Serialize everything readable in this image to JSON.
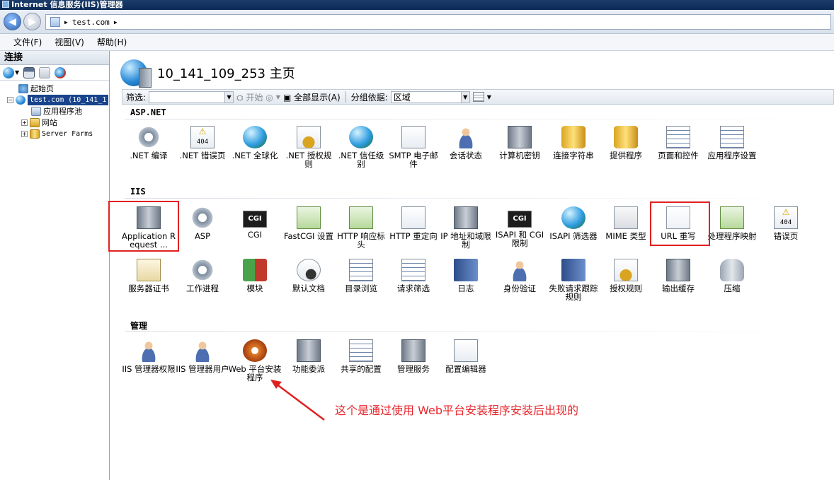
{
  "window": {
    "title": "Internet 信息服务(IIS)管理器"
  },
  "address": {
    "segments": [
      "test.com"
    ]
  },
  "menu": [
    "文件(F)",
    "视图(V)",
    "帮助(H)"
  ],
  "connections": {
    "header": "连接",
    "tree": [
      {
        "label": "起始页"
      },
      {
        "label": "test.com (10_141_1"
      },
      {
        "label": "应用程序池"
      },
      {
        "label": "网站"
      },
      {
        "label": "Server Farms"
      }
    ]
  },
  "main": {
    "title": "10_141_109_253 主页",
    "filter": {
      "label": "筛选:",
      "start": "开始",
      "show_all": "全部显示(A)",
      "group_by_label": "分组依据:",
      "group_by_value": "区域"
    },
    "sections": {
      "aspnet": "ASP.NET",
      "iis": "IIS",
      "manage": "管理"
    },
    "aspnet_features": [
      {
        "label": ".NET 编译",
        "icon": "compile-icon"
      },
      {
        "label": ".NET 错误页",
        "icon": "error-404-icon"
      },
      {
        "label": ".NET 全球化",
        "icon": "globe-icon"
      },
      {
        "label": ".NET 授权规则",
        "icon": "authorization-icon"
      },
      {
        "label": ".NET 信任级别",
        "icon": "trust-icon"
      },
      {
        "label": "SMTP 电子邮件",
        "icon": "smtp-icon"
      },
      {
        "label": "会话状态",
        "icon": "session-icon"
      },
      {
        "label": "计算机密钥",
        "icon": "machine-key-icon"
      },
      {
        "label": "连接字符串",
        "icon": "connection-string-icon"
      },
      {
        "label": "提供程序",
        "icon": "providers-icon"
      },
      {
        "label": "页面和控件",
        "icon": "pages-controls-icon"
      },
      {
        "label": "应用程序设置",
        "icon": "app-settings-icon"
      }
    ],
    "iis_features": [
      {
        "label": "Application Request ...",
        "icon": "arr-icon"
      },
      {
        "label": "ASP",
        "icon": "asp-icon"
      },
      {
        "label": "CGI",
        "icon": "cgi-icon"
      },
      {
        "label": "FastCGI 设置",
        "icon": "fastcgi-icon"
      },
      {
        "label": "HTTP 响应标头",
        "icon": "http-headers-icon"
      },
      {
        "label": "HTTP 重定向",
        "icon": "http-redirect-icon"
      },
      {
        "label": "IP 地址和域限制",
        "icon": "ip-restrictions-icon"
      },
      {
        "label": "ISAPI 和 CGI 限制",
        "icon": "isapi-cgi-icon"
      },
      {
        "label": "ISAPI 筛选器",
        "icon": "isapi-filters-icon"
      },
      {
        "label": "MIME 类型",
        "icon": "mime-icon"
      },
      {
        "label": "URL 重写",
        "icon": "url-rewrite-icon"
      },
      {
        "label": "处理程序映射",
        "icon": "handler-mappings-icon"
      },
      {
        "label": "错误页",
        "icon": "error-pages-icon"
      },
      {
        "label": "服务器证书",
        "icon": "certificate-icon"
      },
      {
        "label": "工作进程",
        "icon": "worker-process-icon"
      },
      {
        "label": "模块",
        "icon": "modules-icon"
      },
      {
        "label": "默认文档",
        "icon": "default-document-icon"
      },
      {
        "label": "目录浏览",
        "icon": "directory-browsing-icon"
      },
      {
        "label": "请求筛选",
        "icon": "request-filtering-icon"
      },
      {
        "label": "日志",
        "icon": "logging-icon"
      },
      {
        "label": "身份验证",
        "icon": "authentication-icon"
      },
      {
        "label": "失败请求跟踪规则",
        "icon": "failed-request-icon"
      },
      {
        "label": "授权规则",
        "icon": "authorization-rules-icon"
      },
      {
        "label": "输出缓存",
        "icon": "output-cache-icon"
      },
      {
        "label": "压缩",
        "icon": "compression-icon"
      }
    ],
    "manage_features": [
      {
        "label": "IIS 管理器权限",
        "icon": "manager-permissions-icon"
      },
      {
        "label": "IIS 管理器用户",
        "icon": "manager-users-icon"
      },
      {
        "label": "Web 平台安装程序",
        "icon": "web-platform-installer-icon"
      },
      {
        "label": "功能委派",
        "icon": "feature-delegation-icon"
      },
      {
        "label": "共享的配置",
        "icon": "shared-config-icon"
      },
      {
        "label": "管理服务",
        "icon": "management-service-icon"
      },
      {
        "label": "配置编辑器",
        "icon": "config-editor-icon"
      }
    ]
  },
  "annotation": {
    "text": "这个是通过使用 Web平台安装程序安装后出现的",
    "color": "#e8262c"
  },
  "colors": {
    "selection": "#19448c",
    "highlight_box": "#e02020"
  }
}
